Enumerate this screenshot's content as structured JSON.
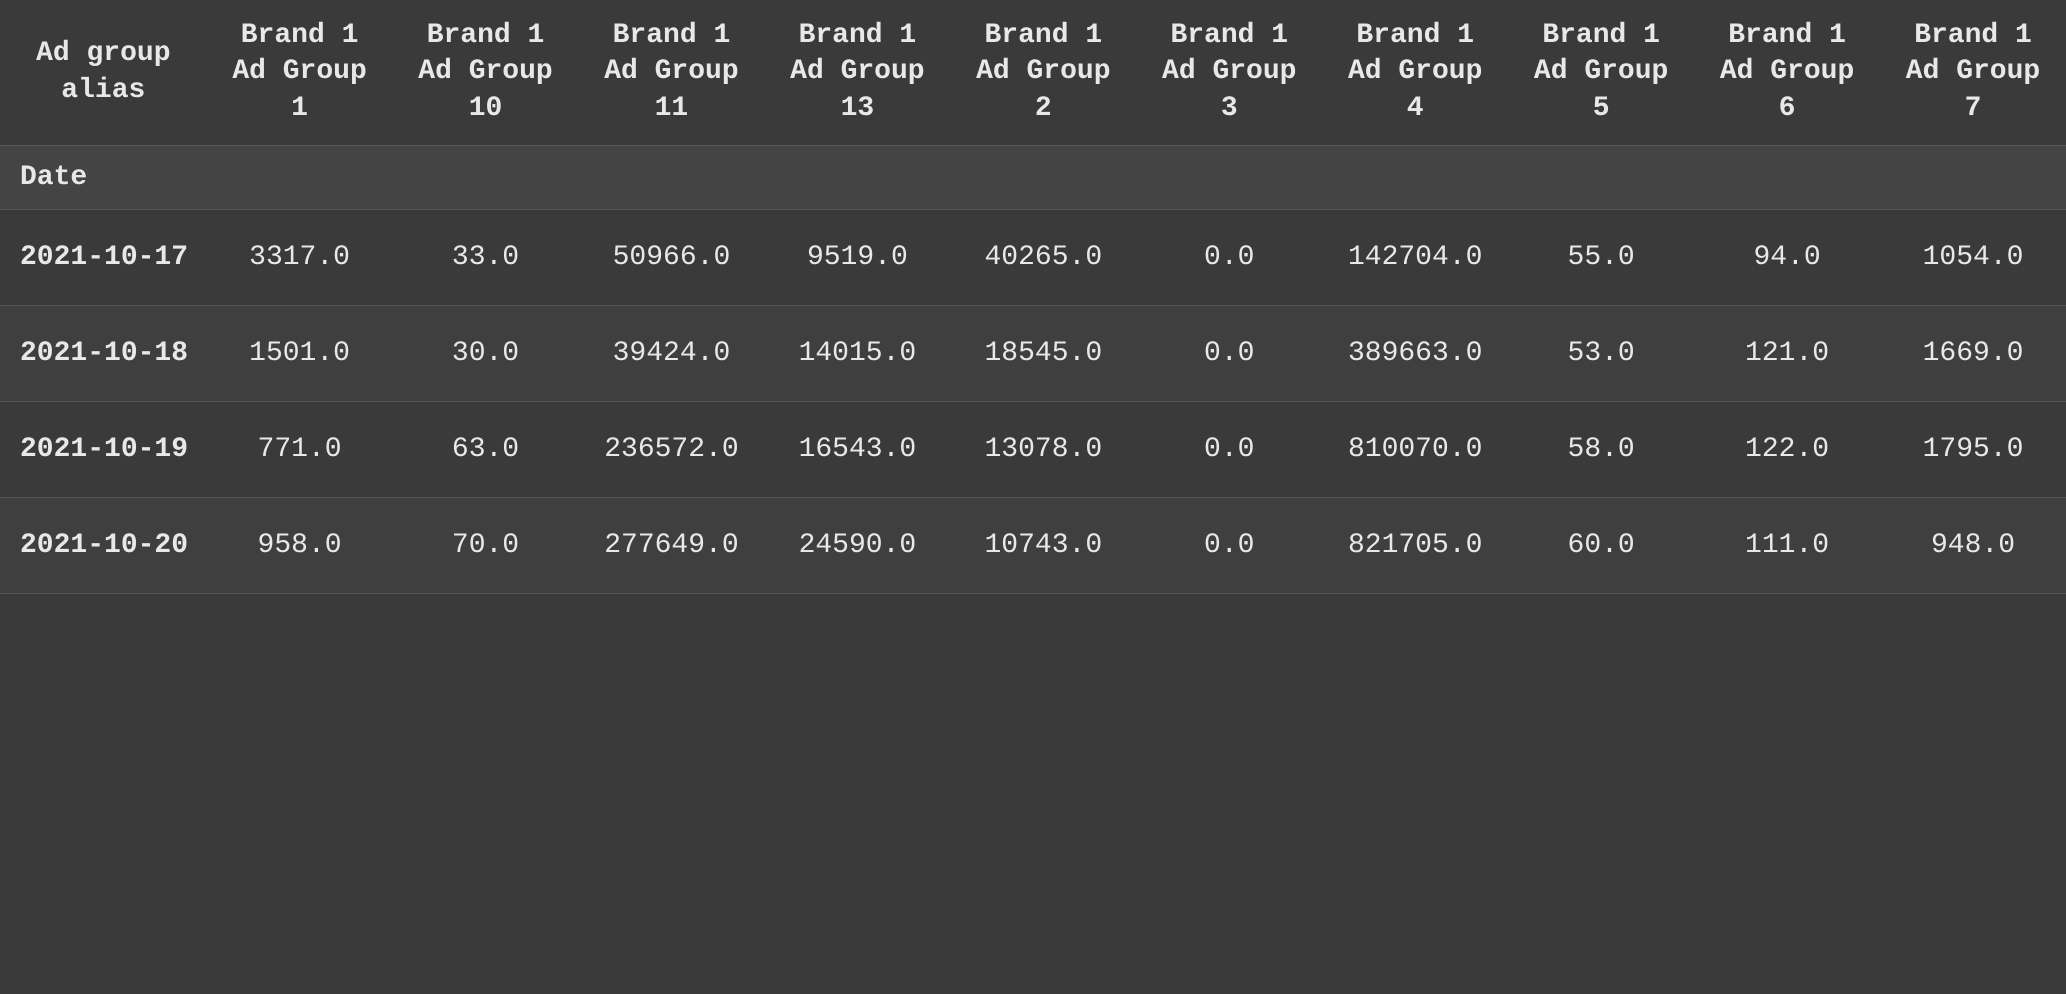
{
  "table": {
    "columns": [
      {
        "id": "alias",
        "label": "Ad group alias"
      },
      {
        "id": "col1",
        "label": "Brand 1 Ad Group 1"
      },
      {
        "id": "col2",
        "label": "Brand 1 Ad Group 10"
      },
      {
        "id": "col3",
        "label": "Brand 1 Ad Group 11"
      },
      {
        "id": "col4",
        "label": "Brand 1 Ad Group 13"
      },
      {
        "id": "col5",
        "label": "Brand 1 Ad Group 2"
      },
      {
        "id": "col6",
        "label": "Brand 1 Ad Group 3"
      },
      {
        "id": "col7",
        "label": "Brand 1 Ad Group 4"
      },
      {
        "id": "col8",
        "label": "Brand 1 Ad Group 5"
      },
      {
        "id": "col9",
        "label": "Brand 1 Ad Group 6"
      },
      {
        "id": "col10",
        "label": "Brand 1 Ad Group 7"
      }
    ],
    "subheader": "Date",
    "rows": [
      {
        "date": "2021-10-17",
        "values": [
          "3317.0",
          "33.0",
          "50966.0",
          "9519.0",
          "40265.0",
          "0.0",
          "142704.0",
          "55.0",
          "94.0",
          "1054.0"
        ]
      },
      {
        "date": "2021-10-18",
        "values": [
          "1501.0",
          "30.0",
          "39424.0",
          "14015.0",
          "18545.0",
          "0.0",
          "389663.0",
          "53.0",
          "121.0",
          "1669.0"
        ]
      },
      {
        "date": "2021-10-19",
        "values": [
          "771.0",
          "63.0",
          "236572.0",
          "16543.0",
          "13078.0",
          "0.0",
          "810070.0",
          "58.0",
          "122.0",
          "1795.0"
        ]
      },
      {
        "date": "2021-10-20",
        "values": [
          "958.0",
          "70.0",
          "277649.0",
          "24590.0",
          "10743.0",
          "0.0",
          "821705.0",
          "60.0",
          "111.0",
          "948.0"
        ]
      }
    ]
  }
}
